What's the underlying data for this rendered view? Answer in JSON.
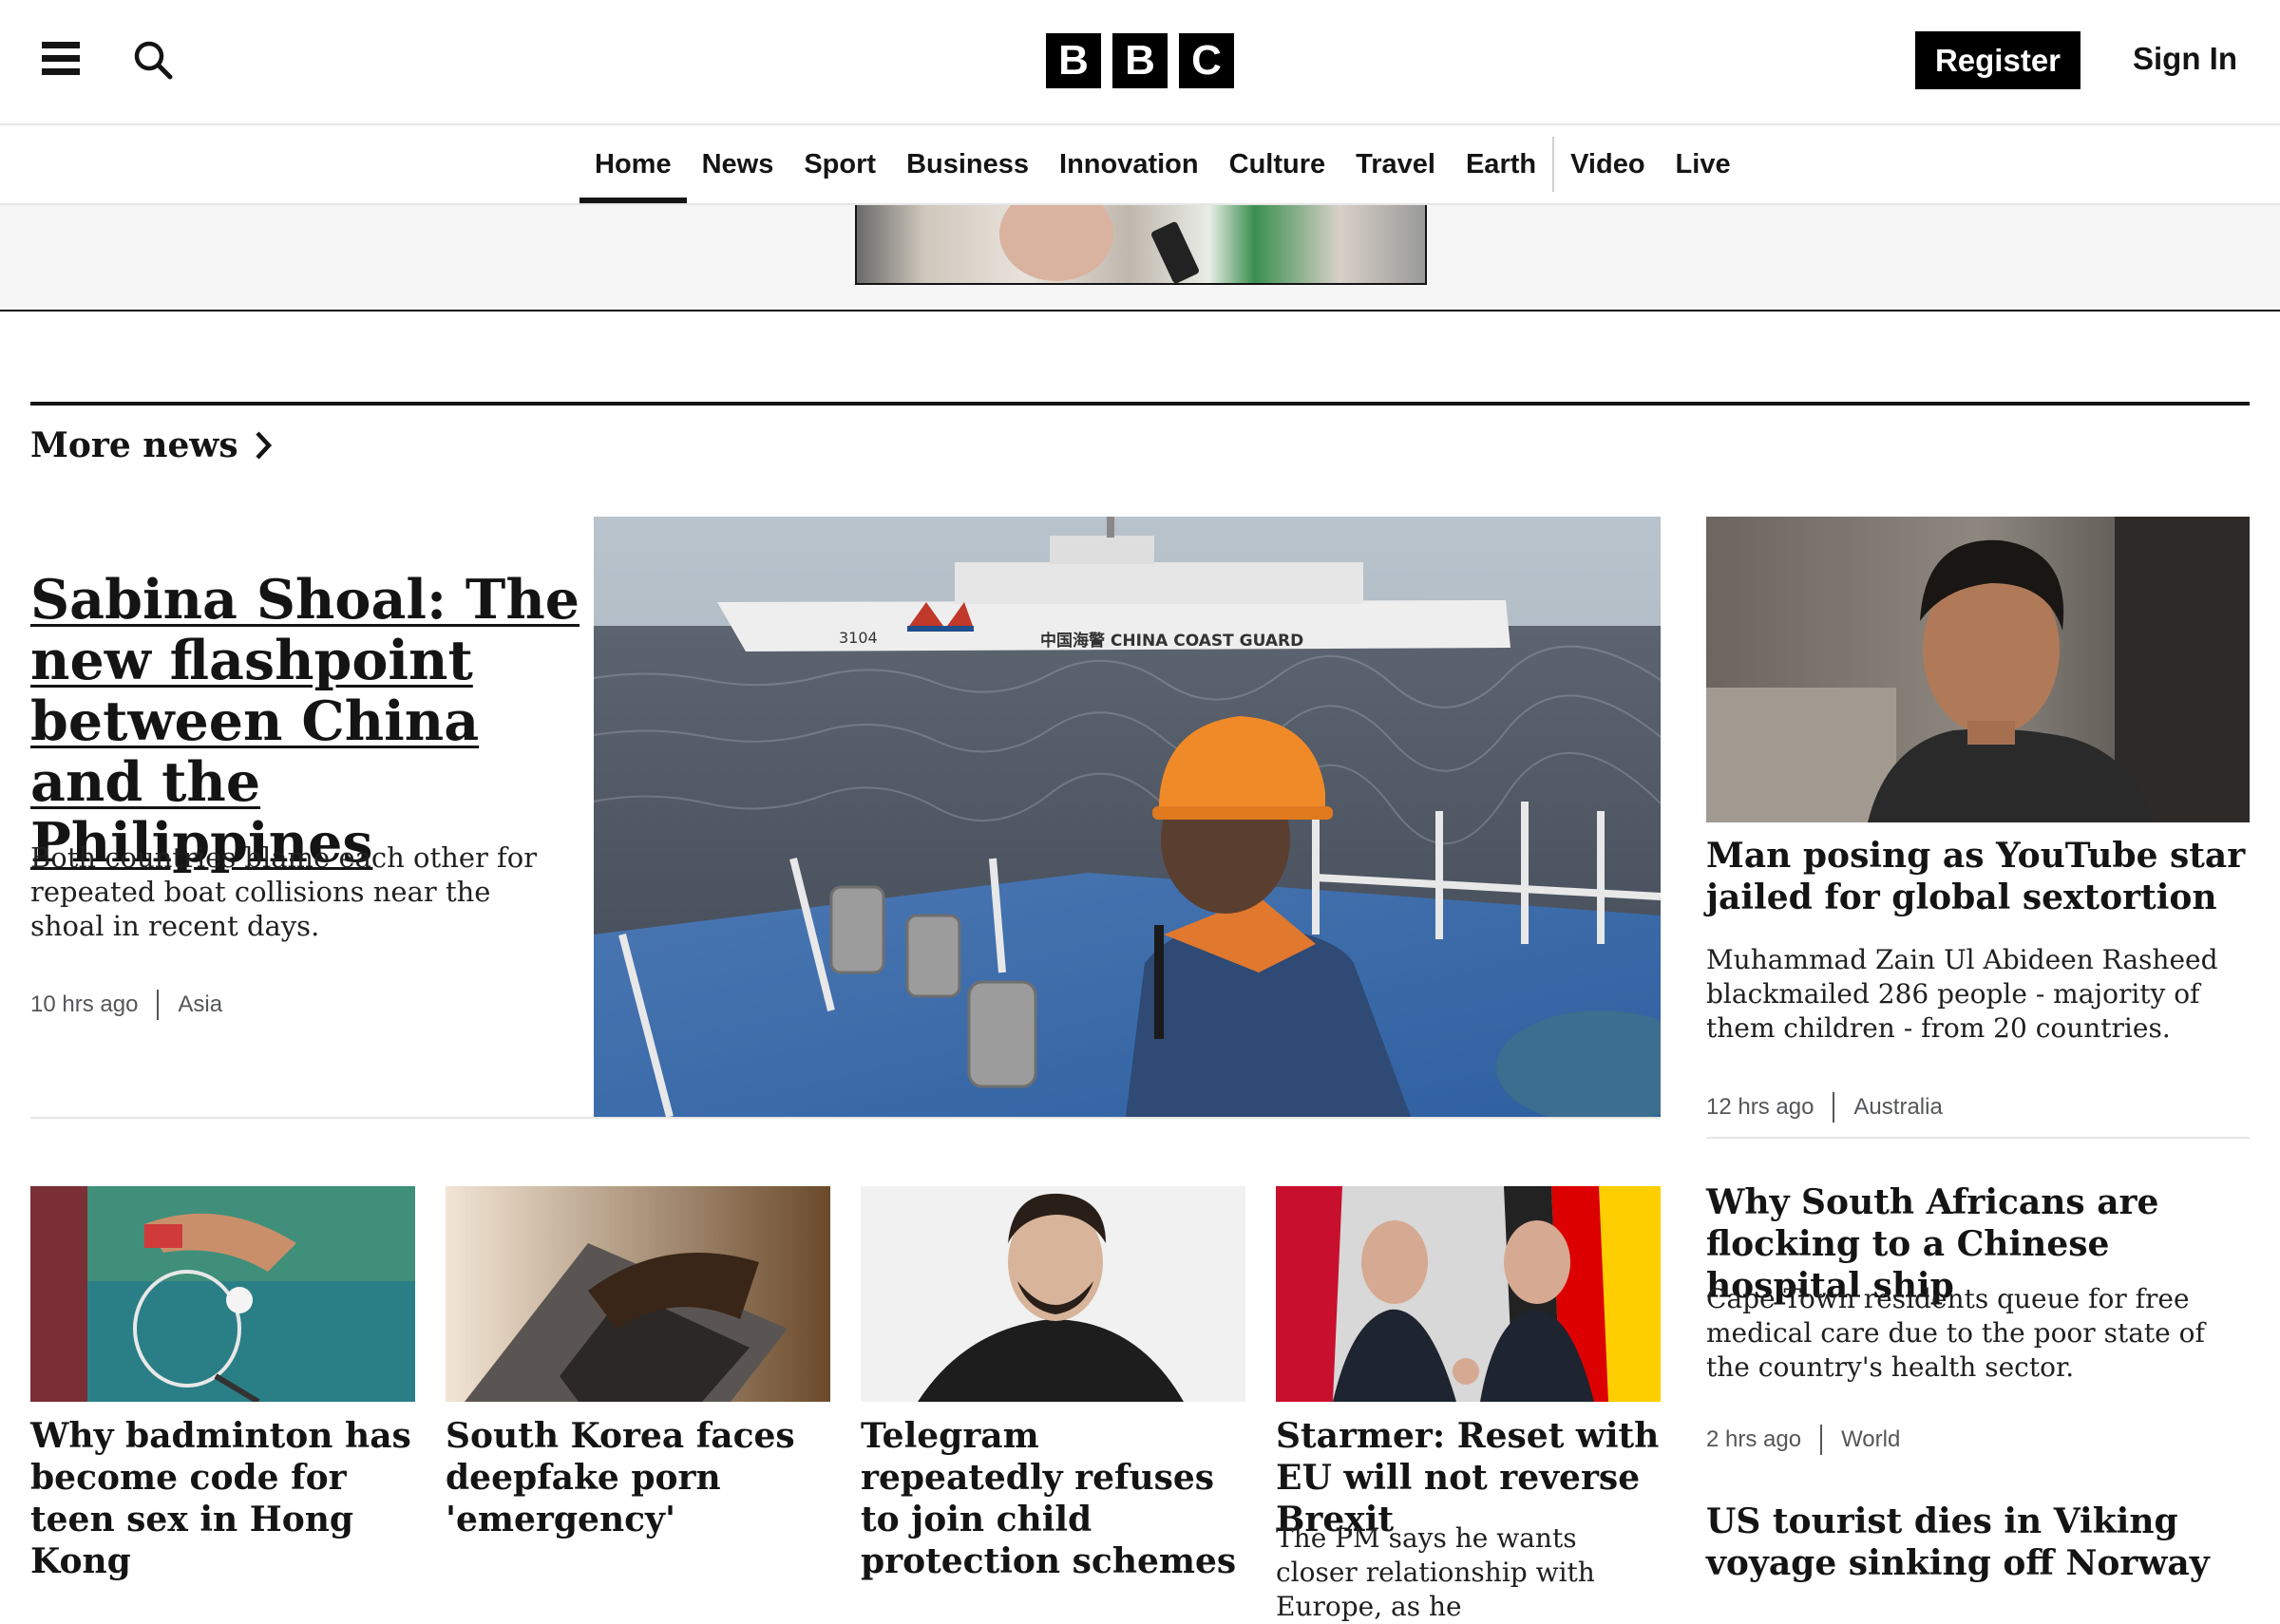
{
  "header": {
    "logo_letters": [
      "B",
      "B",
      "C"
    ],
    "register_label": "Register",
    "signin_label": "Sign In",
    "icons": [
      "menu-icon",
      "search-icon"
    ]
  },
  "nav": {
    "items": [
      "Home",
      "News",
      "Sport",
      "Business",
      "Innovation",
      "Culture",
      "Travel",
      "Earth",
      "Video",
      "Live"
    ],
    "active": "Home"
  },
  "section": {
    "title": "More news"
  },
  "lead": {
    "title": "Sabina Shoal: The new flashpoint between China and the Philippines",
    "description": "Both countries blame each other for repeated boat collisions near the shoal in recent days.",
    "time": "10 hrs ago",
    "category": "Asia",
    "image": {
      "ship_number": "3104",
      "ship_text": "中国海警 CHINA COAST GUARD"
    }
  },
  "right": [
    {
      "title": "Man posing as YouTube star jailed for global sextortion",
      "description": "Muhammad Zain Ul Abideen Rasheed blackmailed 286 people - majority of them children - from 20 countries.",
      "time": "12 hrs ago",
      "category": "Australia"
    },
    {
      "title": "Why South Africans are flocking to a Chinese hospital ship",
      "description": "Cape Town residents queue for free medical care due to the poor state of the country's health sector.",
      "time": "2 hrs ago",
      "category": "World"
    },
    {
      "title": "US tourist dies in Viking voyage sinking off Norway"
    }
  ],
  "cards": [
    {
      "title": "Why badminton has become code for teen sex in Hong Kong"
    },
    {
      "title": "South Korea faces deepfake porn 'emergency'"
    },
    {
      "title": "Telegram repeatedly refuses to join child protection schemes"
    },
    {
      "title": "Starmer: Reset with EU will not reverse Brexit",
      "description": "The PM says he wants closer relationship with Europe, as he"
    }
  ]
}
